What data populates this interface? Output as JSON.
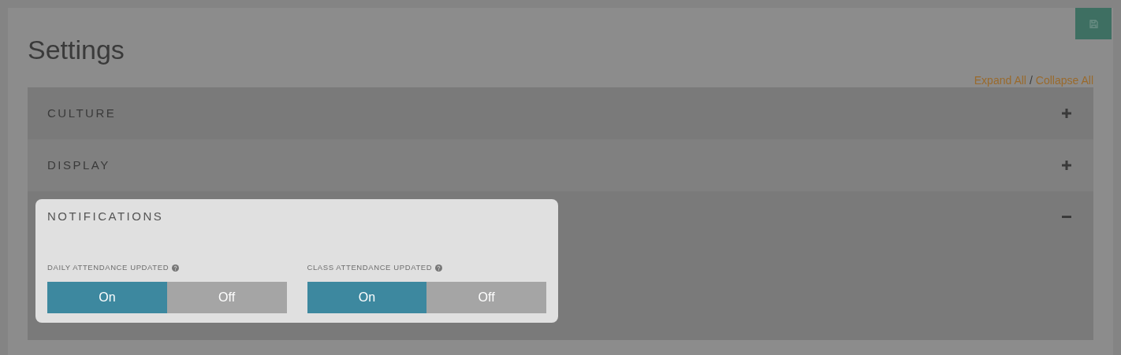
{
  "title": "Settings",
  "links": [
    {
      "label": "Expand All"
    },
    {
      "label": "Collapse All"
    }
  ],
  "link_separator": "/",
  "sections": [
    {
      "title": "CULTURE",
      "expanded": false,
      "highlighted": false
    },
    {
      "title": "DISPLAY",
      "expanded": false,
      "highlighted": false
    },
    {
      "title": "NOTIFICATIONS",
      "expanded": true,
      "highlighted": true,
      "settings": [
        {
          "label": "DAILY ATTENDANCE UPDATED",
          "options": [
            {
              "label": "On",
              "selected": true
            },
            {
              "label": "Off",
              "selected": false
            }
          ]
        },
        {
          "label": "CLASS ATTENDANCE UPDATED",
          "options": [
            {
              "label": "On",
              "selected": true
            },
            {
              "label": "Off",
              "selected": false
            }
          ]
        }
      ]
    }
  ]
}
